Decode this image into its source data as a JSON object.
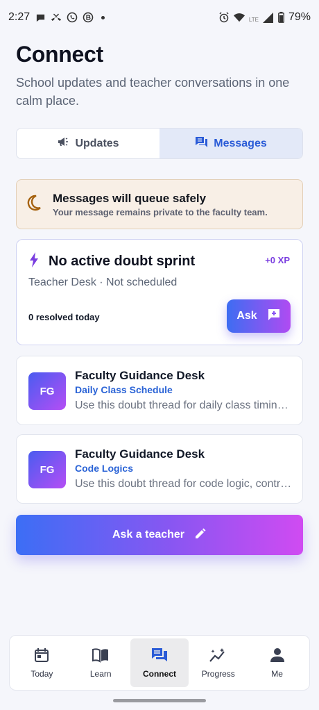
{
  "status_bar": {
    "time": "2:27",
    "battery": "79%",
    "network": "LTE"
  },
  "header": {
    "title": "Connect",
    "subtitle": "School updates and teacher conversations in one calm place."
  },
  "tabs": [
    {
      "label": "Updates",
      "icon": "megaphone-icon",
      "active": false
    },
    {
      "label": "Messages",
      "icon": "chat-icon",
      "active": true
    }
  ],
  "notice": {
    "title": "Messages will queue safely",
    "subtitle": "Your message remains private to the faculty team."
  },
  "sprint": {
    "title": "No active doubt sprint",
    "xp": "+0 XP",
    "meta": "Teacher Desk · Not scheduled",
    "resolved": "0 resolved today",
    "ask_label": "Ask"
  },
  "threads": [
    {
      "initials": "FG",
      "name": "Faculty Guidance Desk",
      "tag": "Daily Class Schedule",
      "preview": "Use this doubt thread for daily class timing, schedule changes and reminders."
    },
    {
      "initials": "FG",
      "name": "Faculty Guidance Desk",
      "tag": "Code Logics",
      "preview": "Use this doubt thread for code logic, control flow and debugging questions."
    }
  ],
  "cta": {
    "label": "Ask a teacher"
  },
  "bottom_nav": [
    {
      "label": "Today",
      "icon": "calendar-icon",
      "active": false
    },
    {
      "label": "Learn",
      "icon": "book-icon",
      "active": false
    },
    {
      "label": "Connect",
      "icon": "chat-icon",
      "active": true
    },
    {
      "label": "Progress",
      "icon": "sparkle-chart-icon",
      "active": false
    },
    {
      "label": "Me",
      "icon": "person-icon",
      "active": false
    }
  ],
  "colors": {
    "accent": "#2a5bd7",
    "gradient_start": "#3c6ef5",
    "gradient_end": "#d04bf2",
    "notice_bg": "#f8efe6",
    "xp": "#7a3ee0"
  }
}
